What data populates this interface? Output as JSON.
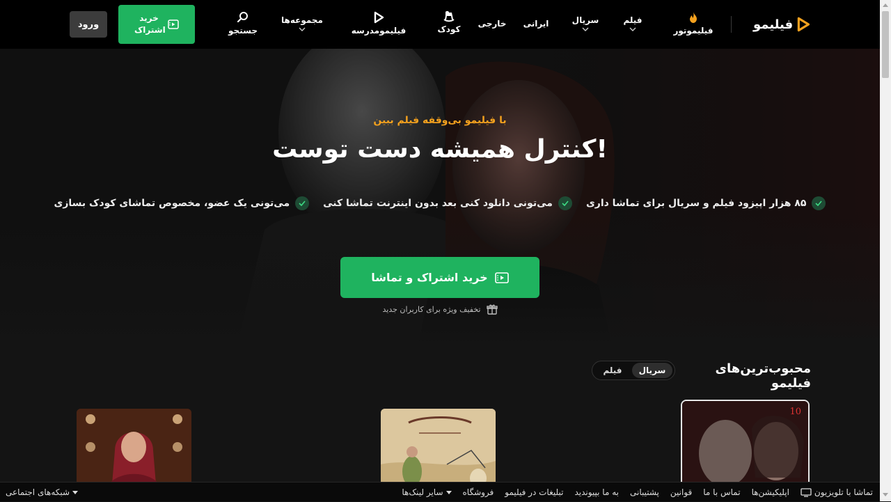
{
  "brand": {
    "name": "فیلیمو",
    "accent": "#f4a11e",
    "green": "#1fb35f"
  },
  "nav": {
    "filimotor": "فیلیموتور",
    "film": "فیلم",
    "serial": "سریال",
    "irani": "ایرانی",
    "khareji": "خارجی",
    "kids": "کودک",
    "school": "فیلیمومدرسه",
    "collections": "مجموعه‌ها",
    "search": "جستجو"
  },
  "header": {
    "subscribe_line1": "خرید",
    "subscribe_line2": "اشتراک",
    "login": "ورود"
  },
  "hero": {
    "tagline": "با فیلیمو بی‌وقفه فیلم ببین",
    "title": "کنترل همیشه دست توست!",
    "features": [
      "۸۵ هزار اپیزود فیلم و سریال برای تماشا داری",
      "می‌تونی دانلود کنی بعد بدون اینترنت تماشا کنی",
      "می‌تونی یک عضو، مخصوص تماشای کودک بسازی"
    ],
    "cta": "خرید اشتراک و تماشا",
    "discount": "تخفیف ویژه برای کاربران جدید"
  },
  "popular": {
    "title": "محبوب‌ترین‌های فیلیمو",
    "tabs": [
      "سریال",
      "فیلم"
    ],
    "active_tab": "سریال",
    "card1_badge": "10"
  },
  "footer": {
    "links": [
      "تماشا با تلویزیون",
      "اپلیکیشن‌ها",
      "تماس با ما",
      "قوانین",
      "پشتیبانی",
      "به ما بپیوندید",
      "تبلیغات در فیلیمو",
      "فروشگاه",
      "سایر لینک‌ها"
    ],
    "social": "شبکه‌های اجتماعی"
  }
}
